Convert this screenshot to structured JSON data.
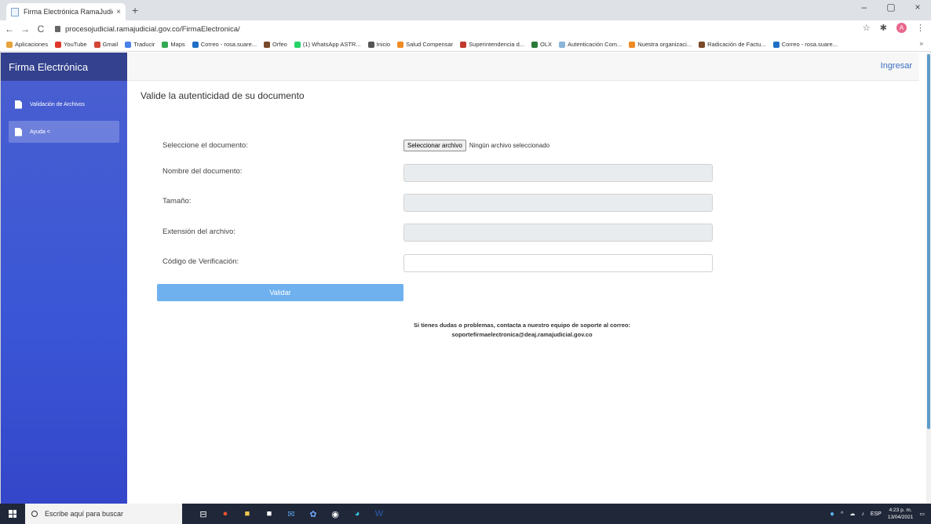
{
  "browser": {
    "tab_title": "Firma Electrónica RamaJudicial",
    "tab_close": "×",
    "new_tab": "+",
    "window_controls": [
      "–",
      "▢",
      "×"
    ],
    "nav": {
      "back": "←",
      "forward": "→",
      "reload": "C"
    },
    "url": "procesojudicial.ramajudicial.gov.co/FirmaElectronica/",
    "star": "☆",
    "extensions": "✱",
    "profile_initial": "A",
    "menu": "⋮"
  },
  "bookmarks": {
    "items": [
      {
        "label": "Aplicaciones",
        "color": "#e8a33b"
      },
      {
        "label": "YouTube",
        "color": "#e0362c"
      },
      {
        "label": "Gmail",
        "color": "#d44638"
      },
      {
        "label": "Traducir",
        "color": "#4a80ea"
      },
      {
        "label": "Maps",
        "color": "#34a853"
      },
      {
        "label": "Correo - rosa.suare...",
        "color": "#1f6fc5"
      },
      {
        "label": "Orfeo",
        "color": "#7a4a2a"
      },
      {
        "label": "(1) WhatsApp ASTR...",
        "color": "#25d366"
      },
      {
        "label": "Inicio",
        "color": "#555555"
      },
      {
        "label": "Salud Compensar",
        "color": "#f08a24"
      },
      {
        "label": "Superintendencia d...",
        "color": "#c0392b"
      },
      {
        "label": "OLX",
        "color": "#2a7a3a"
      },
      {
        "label": "Autenticación Com...",
        "color": "#8ab4d8"
      },
      {
        "label": "Nuestra organizaci...",
        "color": "#f08a24"
      },
      {
        "label": "Radicación de Factu...",
        "color": "#7a4a2a"
      },
      {
        "label": "Correo - rosa.suare...",
        "color": "#1f6fc5"
      }
    ],
    "more": "»"
  },
  "sidebar": {
    "brand": "Firma Electrónica",
    "items": [
      {
        "label": "Validación de Archivos"
      },
      {
        "label": "Ayuda  <"
      }
    ]
  },
  "topbar": {
    "login": "Ingresar"
  },
  "form": {
    "heading": "Valide la autenticidad de su documento",
    "select_label": "Seleccione el documento:",
    "file_button": "Seleccionar archivo",
    "file_status": "Ningún archivo seleccionado",
    "name_label": "Nombre del documento:",
    "size_label": "Tamaño:",
    "ext_label": "Extensión del archivo:",
    "code_label": "Código de Verificación:",
    "code_value": "",
    "submit": "Validar"
  },
  "support": {
    "line1": "Si tienes dudas o problemas, contacta a nuestro equipo de soporte al correo:",
    "email": "soportefirmaelectronica@deaj.ramajudicial.gov.co"
  },
  "taskbar": {
    "search_placeholder": "Escribe aquí para buscar",
    "apps": [
      {
        "glyph": "⊟",
        "color": "#ffffff"
      },
      {
        "glyph": "●",
        "color": "#e8522e"
      },
      {
        "glyph": "■",
        "color": "#f2c94c"
      },
      {
        "glyph": "■",
        "color": "#ffffff"
      },
      {
        "glyph": "✉",
        "color": "#5aa0e8"
      },
      {
        "glyph": "✿",
        "color": "#6fa8ff"
      },
      {
        "glyph": "◉",
        "color": "#ffffff"
      },
      {
        "glyph": "◕",
        "color": "#3ac1d8"
      },
      {
        "glyph": "W",
        "color": "#2b5fb4"
      }
    ],
    "tray_lang": "ESP",
    "time": "4:23 p. m.",
    "date": "13/04/2021"
  }
}
